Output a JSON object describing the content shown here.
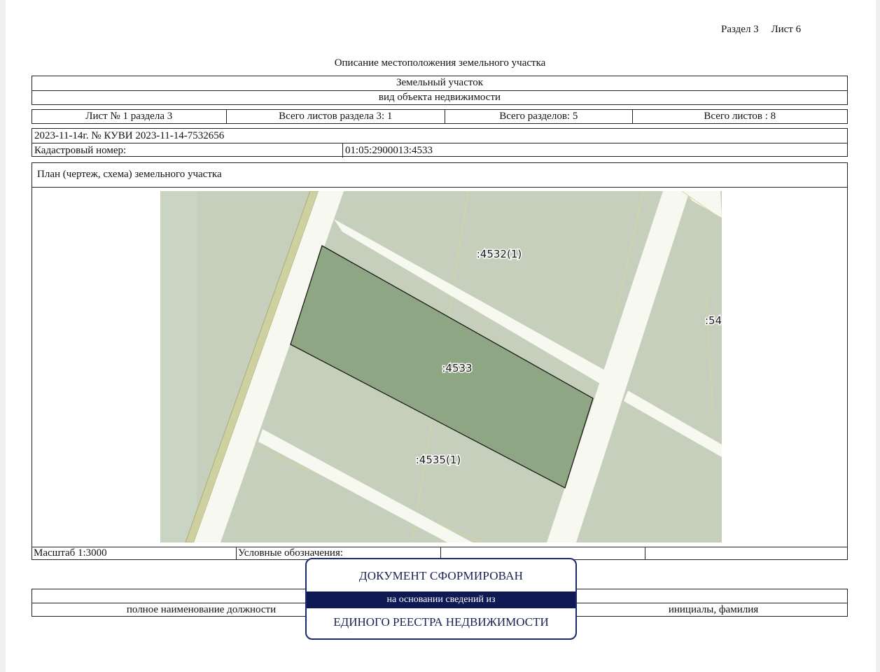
{
  "header": {
    "section": "Раздел 3",
    "sheet": "Лист 6"
  },
  "title": "Описание местоположения земельного участка",
  "object": {
    "name": "Земельный участок",
    "caption": "вид объекта недвижимости"
  },
  "sheets": {
    "sheet_no": "Лист № 1 раздела 3",
    "total_in_section": "Всего листов раздела 3: 1",
    "total_sections": "Всего разделов: 5",
    "total_sheets": "Всего листов : 8"
  },
  "registration": {
    "date_number": "2023-11-14г. № КУВИ 2023-11-14-7532656",
    "cadastral_label": "Кадастровый номер:",
    "cadastral_value": "01:05:2900013:4533"
  },
  "plan": {
    "label": "План (чертеж, схема) земельного участка",
    "parcels": {
      "main": ":4533",
      "north": ":4532(1)",
      "south": ":4535(1)",
      "east": ":54"
    },
    "colors": {
      "background": "#c5cfbc",
      "road": "#f7f9f1",
      "strip": "#cfd0a0",
      "main_parcel": "#8fa684",
      "outline": "#1b1b1b"
    }
  },
  "legend": {
    "scale": "Масштаб 1:3000",
    "symbols": "Условные обозначения:"
  },
  "signature": {
    "position_caption": "полное наименование должности",
    "name_caption": "инициалы, фамилия"
  },
  "stamp": {
    "line1": "ДОКУМЕНТ СФОРМИРОВАН",
    "line2": "на основании сведений из",
    "line3": "ЕДИНОГО РЕЕСТРА НЕДВИЖИМОСТИ",
    "border_color": "#1a2a6e"
  }
}
